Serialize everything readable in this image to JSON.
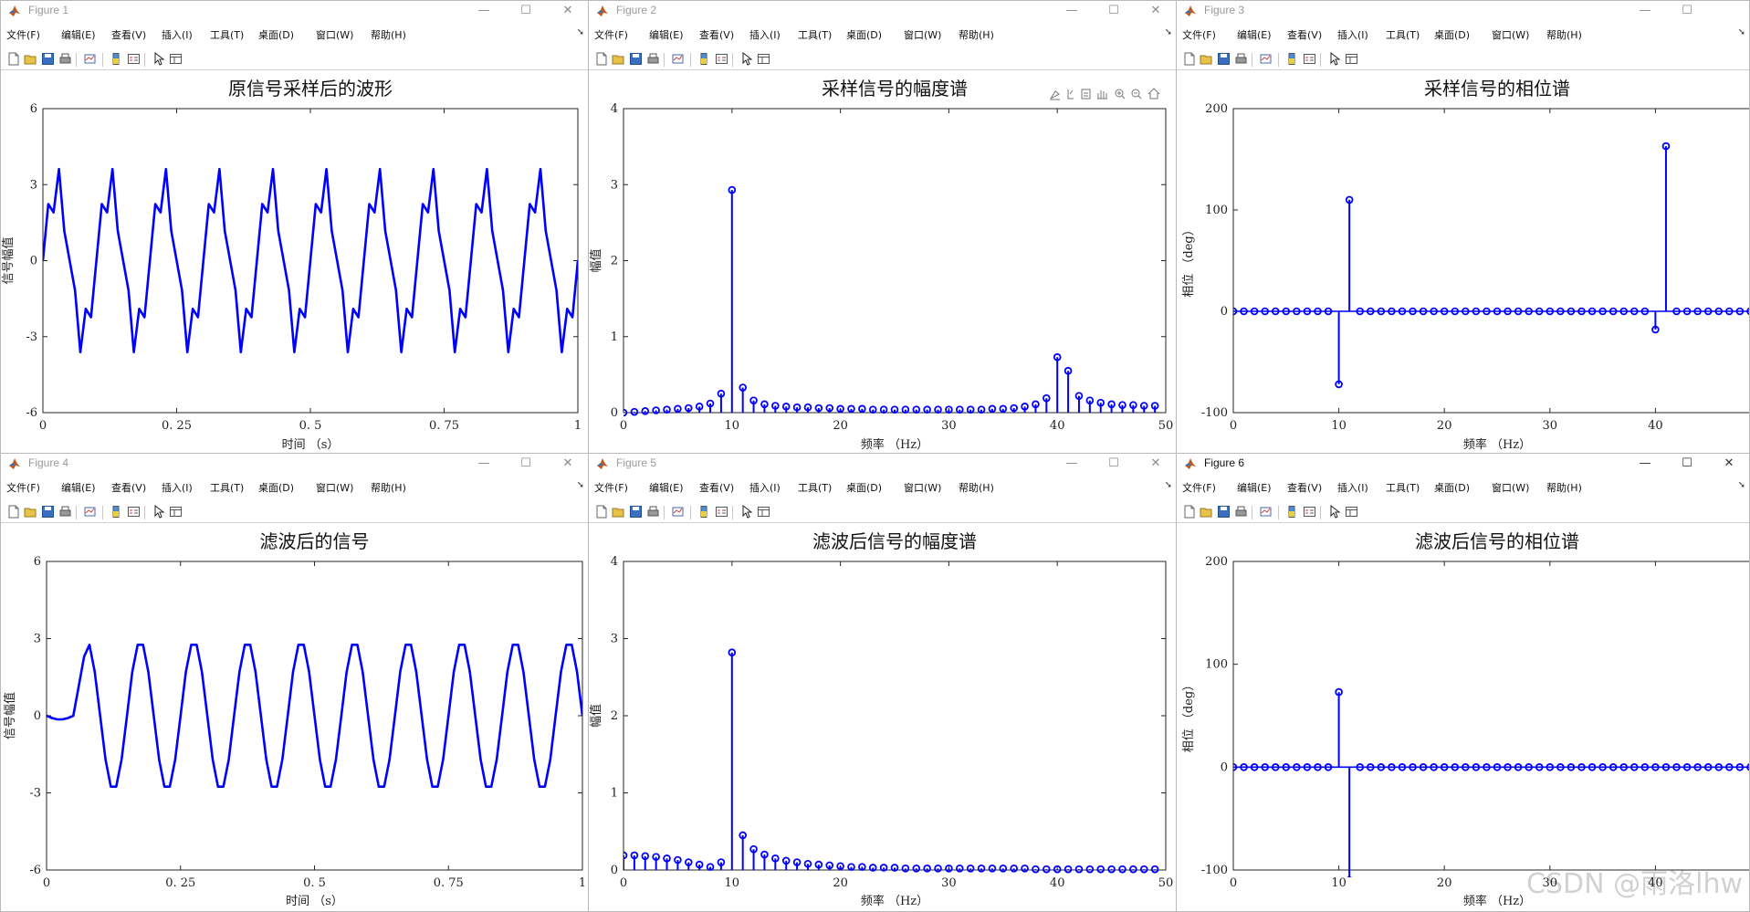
{
  "menu": [
    "文件(F)",
    "编辑(E)",
    "查看(V)",
    "插入(I)",
    "工具(T)",
    "桌面(D)",
    "窗口(W)",
    "帮助(H)"
  ],
  "windows": [
    {
      "title": "Figure 1",
      "chart_data": {
        "type": "line",
        "title": "原信号采样后的波形",
        "xlabel": "时间 （s）",
        "ylabel": "信号幅值",
        "xlim": [
          0,
          1
        ],
        "ylim": [
          -6,
          6
        ],
        "xticks": [
          0,
          0.25,
          0.5,
          0.75,
          1
        ],
        "xtick_labels": [
          "0",
          "0. 25",
          "0. 5",
          "0. 75",
          "1"
        ],
        "yticks": [
          -6,
          -3,
          0,
          3,
          6
        ],
        "ytick_labels": [
          "-6",
          "-3",
          "0",
          "3",
          "6"
        ],
        "color": "#0000ff",
        "signal": "sin(2π·10t)·2.9 + 0.9·sin(2π·40t), sampled at 100 Hz, t = 0 … 1 s"
      }
    },
    {
      "title": "Figure 2",
      "chart_data": {
        "type": "stem",
        "title": "采样信号的幅度谱",
        "xlabel": "频率 （Hz）",
        "ylabel": "幅值",
        "xlim": [
          0,
          50
        ],
        "ylim": [
          0,
          4
        ],
        "xticks": [
          0,
          10,
          20,
          30,
          40,
          50
        ],
        "yticks": [
          0,
          1,
          2,
          3,
          4
        ],
        "color": "#0000ff",
        "x": [
          0,
          1,
          2,
          3,
          4,
          5,
          6,
          7,
          8,
          9,
          10,
          11,
          12,
          13,
          14,
          15,
          16,
          17,
          18,
          19,
          20,
          21,
          22,
          23,
          24,
          25,
          26,
          27,
          28,
          29,
          30,
          31,
          32,
          33,
          34,
          35,
          36,
          37,
          38,
          39,
          40,
          41,
          42,
          43,
          44,
          45,
          46,
          47,
          48,
          49
        ],
        "y": [
          0.0,
          0.01,
          0.02,
          0.03,
          0.04,
          0.05,
          0.06,
          0.08,
          0.12,
          0.25,
          2.93,
          0.33,
          0.16,
          0.11,
          0.09,
          0.08,
          0.07,
          0.07,
          0.06,
          0.06,
          0.05,
          0.05,
          0.05,
          0.04,
          0.04,
          0.04,
          0.04,
          0.04,
          0.04,
          0.04,
          0.04,
          0.04,
          0.04,
          0.04,
          0.05,
          0.05,
          0.06,
          0.08,
          0.11,
          0.19,
          0.73,
          0.55,
          0.22,
          0.16,
          0.13,
          0.11,
          0.1,
          0.1,
          0.09,
          0.09
        ]
      }
    },
    {
      "title": "Figure 3",
      "chart_data": {
        "type": "stem",
        "title": "采样信号的相位谱",
        "xlabel": "频率 （Hz）",
        "ylabel": "相位 （deg）",
        "xlim": [
          0,
          50
        ],
        "ylim": [
          -100,
          200
        ],
        "xticks": [
          0,
          10,
          20,
          30,
          40,
          50
        ],
        "xtick_labels": [
          "0",
          "10",
          "20",
          "30",
          "40",
          "5"
        ],
        "yticks": [
          -100,
          0,
          100,
          200
        ],
        "color": "#0000ff",
        "x": [
          0,
          1,
          2,
          3,
          4,
          5,
          6,
          7,
          8,
          9,
          10,
          11,
          12,
          13,
          14,
          15,
          16,
          17,
          18,
          19,
          20,
          21,
          22,
          23,
          24,
          25,
          26,
          27,
          28,
          29,
          30,
          31,
          32,
          33,
          34,
          35,
          36,
          37,
          38,
          39,
          40,
          41,
          42,
          43,
          44,
          45,
          46,
          47,
          48,
          49
        ],
        "y": [
          0,
          0,
          0,
          0,
          0,
          0,
          0,
          0,
          0,
          0,
          -72,
          110,
          0,
          0,
          0,
          0,
          0,
          0,
          0,
          0,
          0,
          0,
          0,
          0,
          0,
          0,
          0,
          0,
          0,
          0,
          0,
          0,
          0,
          0,
          0,
          0,
          0,
          0,
          0,
          0,
          -18,
          163,
          0,
          0,
          0,
          0,
          0,
          0,
          0,
          0
        ]
      }
    },
    {
      "title": "Figure 4",
      "chart_data": {
        "type": "line",
        "title": "滤波后的信号",
        "xlabel": "时间 （s）",
        "ylabel": "信号幅值",
        "xlim": [
          0,
          1
        ],
        "ylim": [
          -6,
          6
        ],
        "xticks": [
          0,
          0.25,
          0.5,
          0.75,
          1
        ],
        "xtick_labels": [
          "0",
          "0. 25",
          "0. 5",
          "0. 75",
          "1"
        ],
        "yticks": [
          -6,
          -3,
          0,
          3,
          6
        ],
        "ytick_labels": [
          "-6",
          "-3",
          "0",
          "3",
          "6"
        ],
        "color": "#0000ff",
        "signal": "2.9·sin(2π·10(t−0.05)) after a ~0.05 s filter start-up, sampled at 100 Hz"
      }
    },
    {
      "title": "Figure 5",
      "chart_data": {
        "type": "stem",
        "title": "滤波后信号的幅度谱",
        "xlabel": "频率 （Hz）",
        "ylabel": "幅值",
        "xlim": [
          0,
          50
        ],
        "ylim": [
          0,
          4
        ],
        "xticks": [
          0,
          10,
          20,
          30,
          40,
          50
        ],
        "yticks": [
          0,
          1,
          2,
          3,
          4
        ],
        "color": "#0000ff",
        "x": [
          0,
          1,
          2,
          3,
          4,
          5,
          6,
          7,
          8,
          9,
          10,
          11,
          12,
          13,
          14,
          15,
          16,
          17,
          18,
          19,
          20,
          21,
          22,
          23,
          24,
          25,
          26,
          27,
          28,
          29,
          30,
          31,
          32,
          33,
          34,
          35,
          36,
          37,
          38,
          39,
          40,
          41,
          42,
          43,
          44,
          45,
          46,
          47,
          48,
          49
        ],
        "y": [
          0.19,
          0.19,
          0.18,
          0.17,
          0.15,
          0.13,
          0.1,
          0.07,
          0.04,
          0.1,
          2.82,
          0.45,
          0.27,
          0.2,
          0.15,
          0.12,
          0.1,
          0.08,
          0.07,
          0.06,
          0.05,
          0.04,
          0.04,
          0.03,
          0.03,
          0.03,
          0.02,
          0.02,
          0.02,
          0.02,
          0.02,
          0.02,
          0.02,
          0.02,
          0.02,
          0.02,
          0.02,
          0.02,
          0.01,
          0.01,
          0.01,
          0.01,
          0.01,
          0.01,
          0.01,
          0.01,
          0.01,
          0.01,
          0.01,
          0.01
        ]
      }
    },
    {
      "title": "Figure 6",
      "chart_data": {
        "type": "stem",
        "title": "滤波后信号的相位谱",
        "xlabel": "频率 （Hz）",
        "ylabel": "相位 （deg）",
        "xlim": [
          0,
          50
        ],
        "ylim": [
          -100,
          200
        ],
        "xticks": [
          0,
          10,
          20,
          30,
          40
        ],
        "yticks": [
          -100,
          0,
          100,
          200
        ],
        "color": "#0000ff",
        "x": [
          0,
          1,
          2,
          3,
          4,
          5,
          6,
          7,
          8,
          9,
          10,
          11,
          12,
          13,
          14,
          15,
          16,
          17,
          18,
          19,
          20,
          21,
          22,
          23,
          24,
          25,
          26,
          27,
          28,
          29,
          30,
          31,
          32,
          33,
          34,
          35,
          36,
          37,
          38,
          39,
          40,
          41,
          42,
          43,
          44,
          45,
          46,
          47,
          48,
          49
        ],
        "y": [
          0,
          0,
          0,
          0,
          0,
          0,
          0,
          0,
          0,
          0,
          73,
          -110,
          0,
          0,
          0,
          0,
          0,
          0,
          0,
          0,
          0,
          0,
          0,
          0,
          0,
          0,
          0,
          0,
          0,
          0,
          0,
          0,
          0,
          0,
          0,
          0,
          0,
          0,
          0,
          0,
          0,
          0,
          0,
          0,
          0,
          0,
          0,
          0,
          0,
          0
        ]
      }
    }
  ],
  "watermark": "CSDN @雨洛lhw"
}
